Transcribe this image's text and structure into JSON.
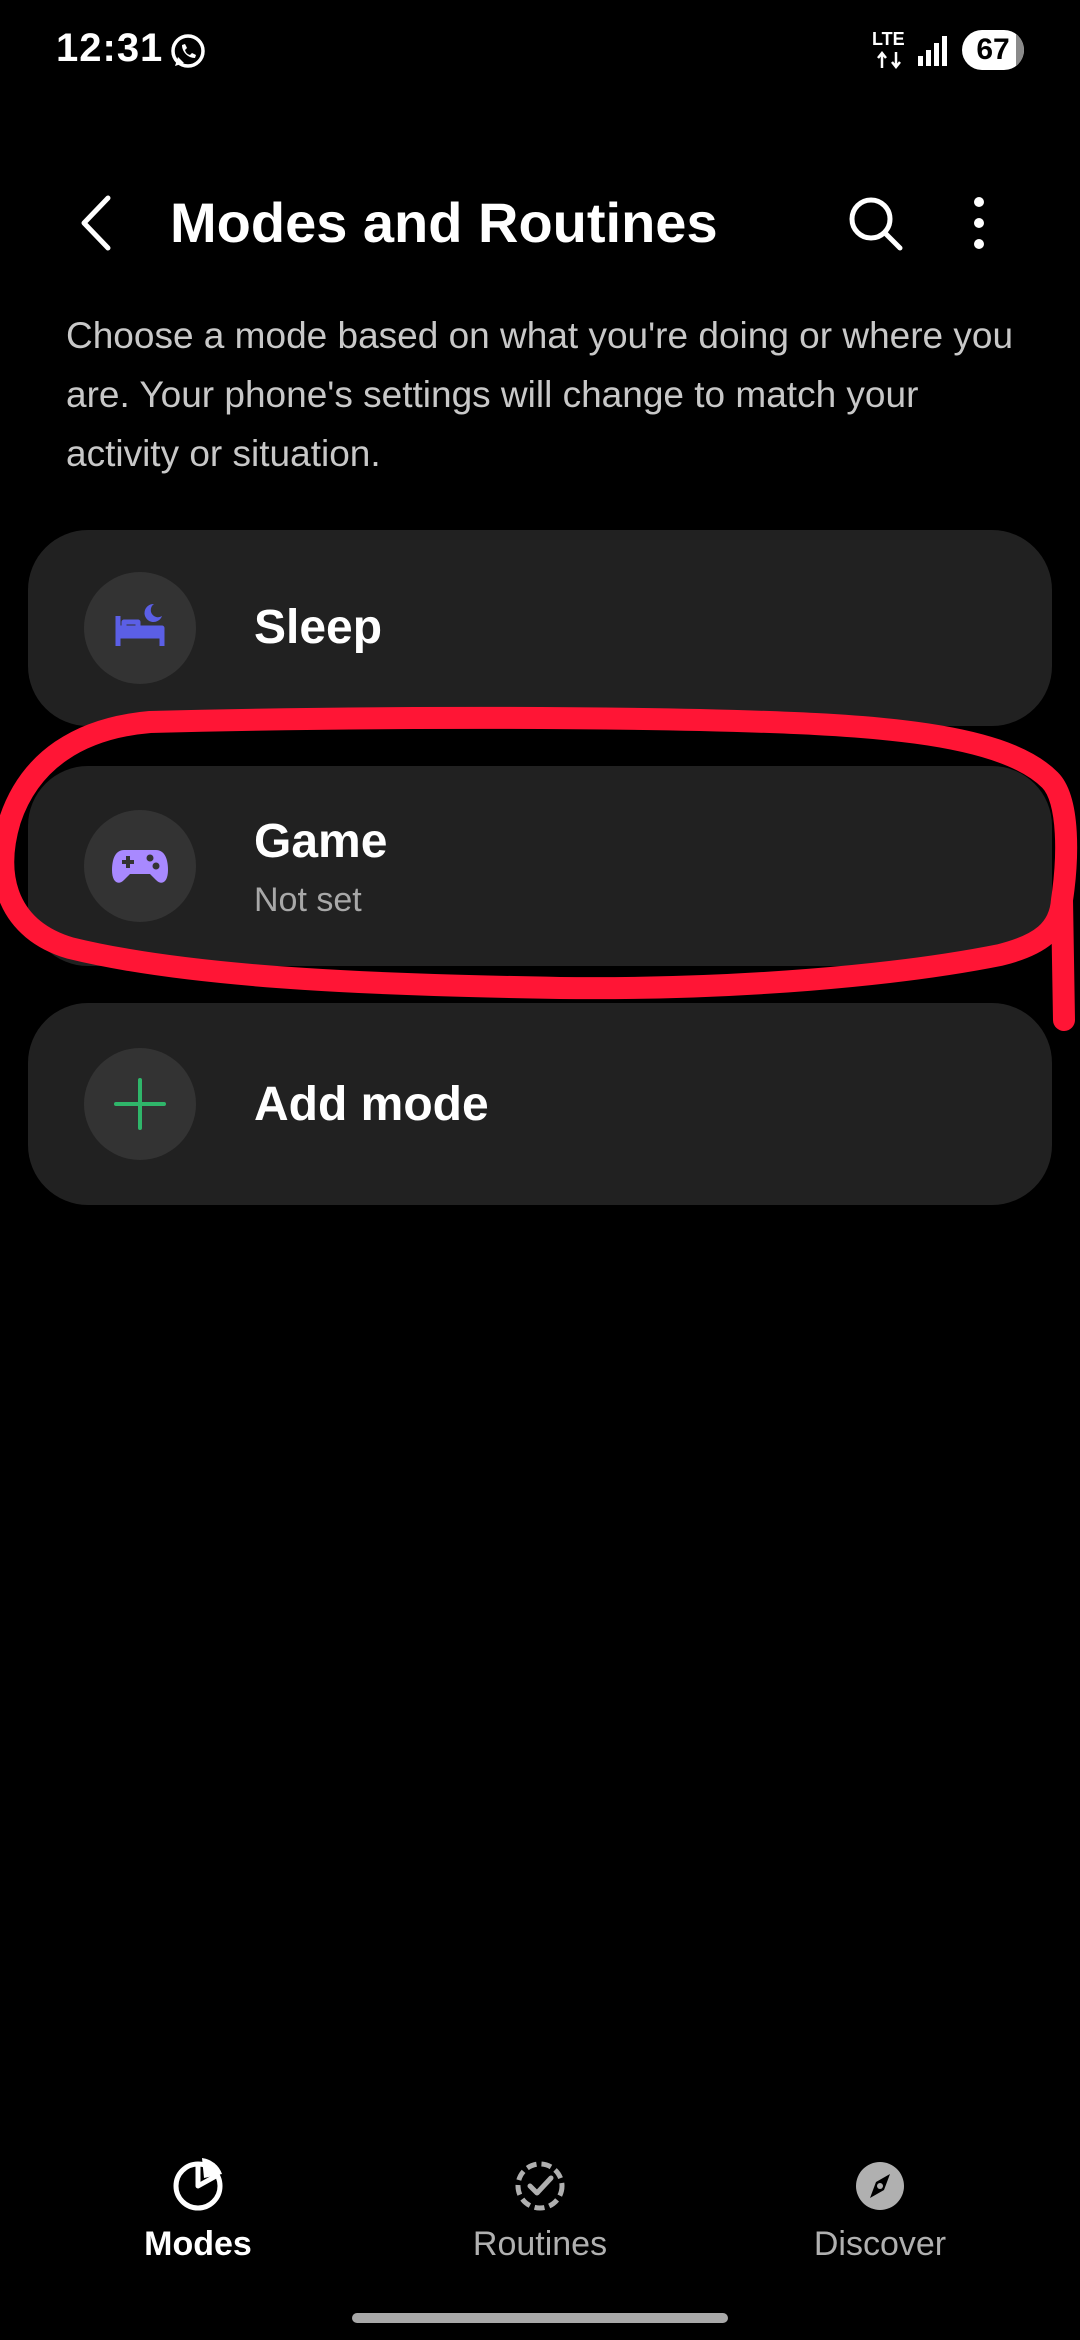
{
  "status_bar": {
    "time": "12:31",
    "network_label": "LTE",
    "battery_level": "67",
    "icons": [
      "whatsapp-icon",
      "lte-icon",
      "signal-icon",
      "battery-icon"
    ]
  },
  "header": {
    "title": "Modes and Routines",
    "icons": [
      "back-arrow-icon",
      "search-icon",
      "more-vert-icon"
    ]
  },
  "description": "Choose a mode based on what you're doing or where you are. Your phone's settings will change to match your activity or situation.",
  "modes": [
    {
      "title": "Sleep",
      "icon": "bed-moon-icon",
      "icon_color": "#5b5fe6"
    },
    {
      "title": "Game",
      "subtitle": "Not set",
      "icon": "gamepad-icon",
      "icon_color": "#a889ff"
    },
    {
      "title": "Add mode",
      "icon": "plus-icon",
      "icon_color": "#2fb66a"
    }
  ],
  "bottom_nav": {
    "items": [
      {
        "label": "Modes",
        "icon": "modes-icon",
        "active": true
      },
      {
        "label": "Routines",
        "icon": "routines-icon",
        "active": false
      },
      {
        "label": "Discover",
        "icon": "compass-icon",
        "active": false
      }
    ]
  },
  "colors": {
    "background": "#000000",
    "card": "#212121",
    "annotation": "#ff1535"
  }
}
